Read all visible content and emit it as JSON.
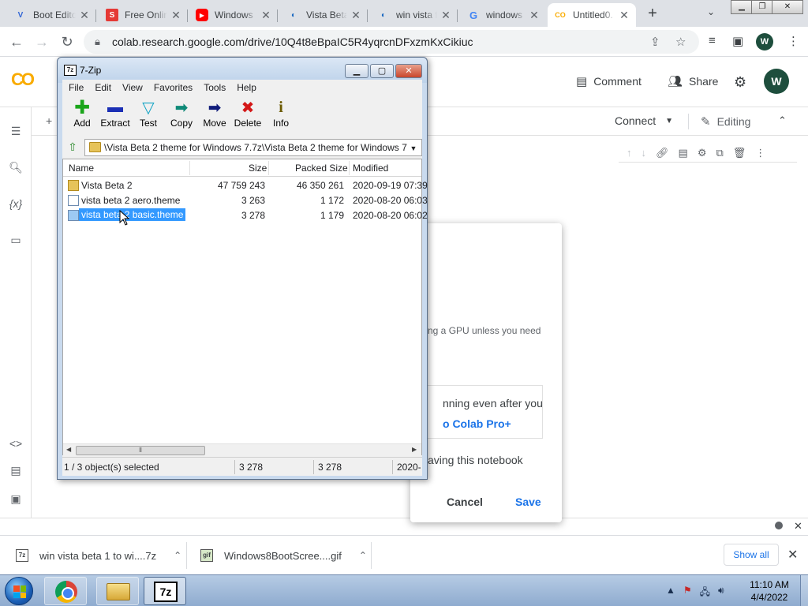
{
  "browser": {
    "tabs": [
      {
        "title": "Boot Edito",
        "favicon": "V"
      },
      {
        "title": "Free Onlin",
        "favicon": "S"
      },
      {
        "title": "Windows",
        "favicon": "▶"
      },
      {
        "title": "Vista Beta",
        "favicon": "◐"
      },
      {
        "title": "win vista f",
        "favicon": "◐"
      },
      {
        "title": "windows",
        "favicon": "G"
      },
      {
        "title": "Untitled0.",
        "favicon": "CO"
      }
    ],
    "new_tab": "+",
    "url": "colab.research.google.com/drive/10Q4t8eBpaIC5R4yqrcnDFxzmKxCikiuc",
    "profile_initial": "W"
  },
  "colab": {
    "logo": "CO",
    "header_actions": {
      "comment": "Comment",
      "share": "Share"
    },
    "avatar": "W",
    "connect": "Connect",
    "editing": "Editing",
    "sidebar_icons": {
      "variables": "{x}",
      "code": "<>"
    }
  },
  "save_dialog": {
    "text_gpu": "ng a GPU unless you need",
    "box_line1": "nning even after you",
    "box_line2": "o Colab Pro+",
    "text_saving": "aving this notebook",
    "cancel": "Cancel",
    "save": "Save"
  },
  "zip": {
    "title": "7-Zip",
    "app_icon": "7z",
    "menu": [
      "File",
      "Edit",
      "View",
      "Favorites",
      "Tools",
      "Help"
    ],
    "tools": [
      {
        "label": "Add",
        "icon": "✚",
        "color": "#1aa51a"
      },
      {
        "label": "Extract",
        "icon": "▬",
        "color": "#1b2fb5"
      },
      {
        "label": "Test",
        "icon": "▽",
        "color": "#11a3c4"
      },
      {
        "label": "Copy",
        "icon": "➡",
        "color": "#0f8a78"
      },
      {
        "label": "Move",
        "icon": "➡",
        "color": "#101c7a"
      },
      {
        "label": "Delete",
        "icon": "✖",
        "color": "#d31717"
      },
      {
        "label": "Info",
        "icon": "i",
        "color": "#6b5a00"
      }
    ],
    "path": "\\Vista Beta 2 theme for Windows 7.7z\\Vista Beta 2 theme for Windows 7\\",
    "columns": {
      "name": "Name",
      "size": "Size",
      "packed": "Packed Size",
      "modified": "Modified"
    },
    "rows": [
      {
        "name": "Vista Beta 2",
        "type": "folder",
        "size": "47 759 243",
        "packed": "46 350 261",
        "modified": "2020-09-19 07:39"
      },
      {
        "name": "vista beta 2 aero.theme",
        "type": "file",
        "size": "3 263",
        "packed": "1 172",
        "modified": "2020-08-20 06:03"
      },
      {
        "name": "vista beta 2 basic.theme",
        "type": "file",
        "size": "3 278",
        "packed": "1 179",
        "modified": "2020-08-20 06:02"
      }
    ],
    "status": {
      "selected": "1 / 3 object(s) selected",
      "size": "3 278",
      "packed": "3 278",
      "modified": "2020-("
    }
  },
  "downloads": {
    "items": [
      {
        "name": "win vista beta 1 to wi....7z",
        "icon": "7z"
      },
      {
        "name": "Windows8BootScree....gif",
        "icon": "gif"
      }
    ],
    "show_all": "Show all"
  },
  "taskbar": {
    "time": "11:10 AM",
    "date": "4/4/2022",
    "zip_label": "7z"
  }
}
